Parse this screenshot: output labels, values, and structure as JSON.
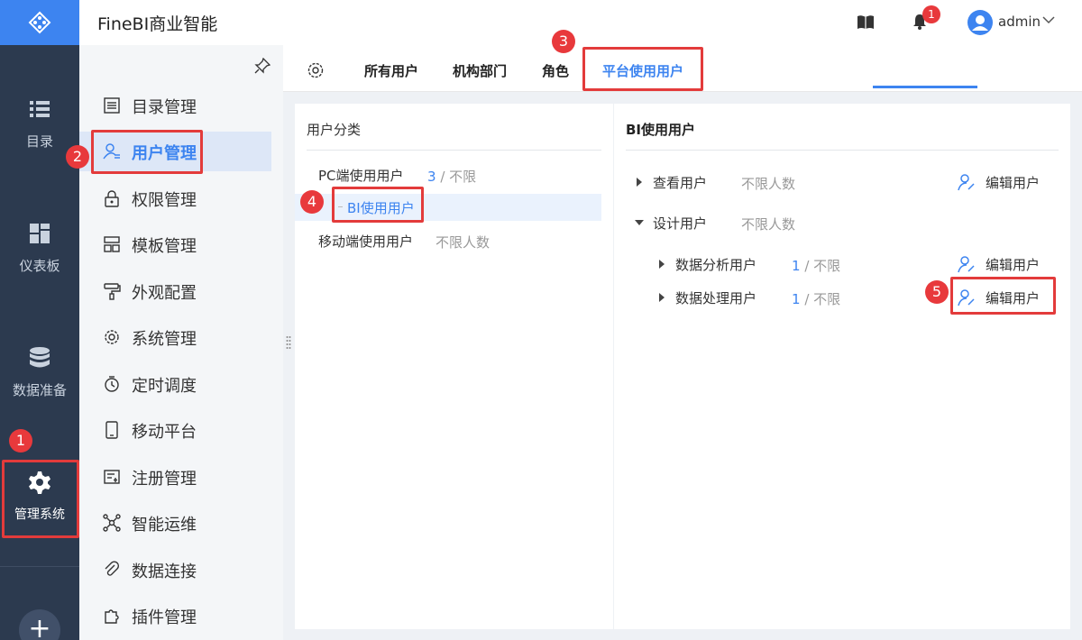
{
  "app": {
    "title": "FineBI商业智能"
  },
  "header": {
    "user": "admin",
    "notif_count": "1"
  },
  "nav": [
    {
      "label": "目录",
      "icon": "list-icon"
    },
    {
      "label": "仪表板",
      "icon": "dashboard-icon"
    },
    {
      "label": "数据准备",
      "icon": "database-icon"
    },
    {
      "label": "管理系统",
      "icon": "gear-icon"
    }
  ],
  "nav_plus": "+",
  "menu": [
    {
      "label": "目录管理",
      "icon": "catalog-icon"
    },
    {
      "label": "用户管理",
      "icon": "user-manage-icon"
    },
    {
      "label": "权限管理",
      "icon": "lock-icon"
    },
    {
      "label": "模板管理",
      "icon": "template-icon"
    },
    {
      "label": "外观配置",
      "icon": "brush-icon"
    },
    {
      "label": "系统管理",
      "icon": "gear-icon"
    },
    {
      "label": "定时调度",
      "icon": "timer-icon"
    },
    {
      "label": "移动平台",
      "icon": "mobile-icon"
    },
    {
      "label": "注册管理",
      "icon": "register-icon"
    },
    {
      "label": "智能运维",
      "icon": "network-icon"
    },
    {
      "label": "数据连接",
      "icon": "link-icon"
    },
    {
      "label": "插件管理",
      "icon": "plugin-icon"
    }
  ],
  "tabs": [
    {
      "label": "所有用户"
    },
    {
      "label": "机构部门"
    },
    {
      "label": "角色"
    },
    {
      "label": "平台使用用户"
    }
  ],
  "left_panel": {
    "title": "用户分类",
    "items": [
      {
        "label": "PC端使用用户",
        "count": "3",
        "limit": " / 不限"
      },
      {
        "label": "BI使用用户"
      },
      {
        "label": "移动端使用用户",
        "limit": "不限人数"
      }
    ]
  },
  "right_panel": {
    "title": "BI使用用户",
    "rows": [
      {
        "label": "查看用户",
        "limit": "不限人数",
        "edit": "编辑用户"
      },
      {
        "label": "设计用户",
        "limit": "不限人数"
      },
      {
        "label": "数据分析用户",
        "count": "1",
        "limit": " / 不限",
        "edit": "编辑用户"
      },
      {
        "label": "数据处理用户",
        "count": "1",
        "limit": " / 不限",
        "edit": "编辑用户"
      }
    ]
  },
  "annotations": [
    "1",
    "2",
    "3",
    "4",
    "5"
  ],
  "colors": {
    "accent": "#3d84f0",
    "nav_bg": "#2c3a4f",
    "highlight": "#e33b3b"
  }
}
